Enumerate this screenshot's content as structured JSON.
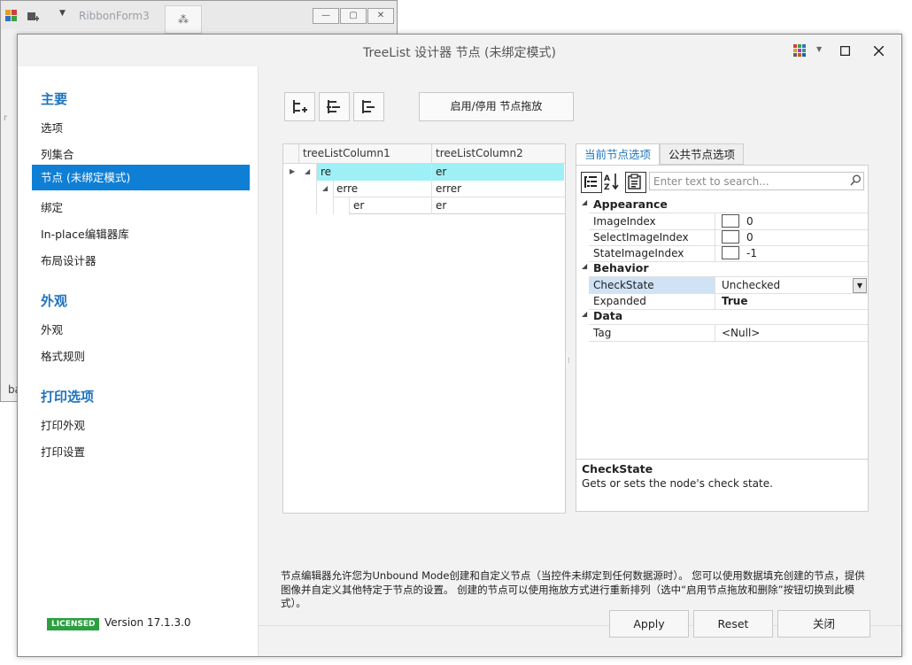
{
  "background_window": {
    "title": "RibbonForm3",
    "ba_text": "ba",
    "r_text": "r"
  },
  "dialog": {
    "title": "TreeList 设计器 节点 (未绑定模式)",
    "icons": [
      "palette-icon",
      "dropdown-arrow-icon",
      "maximize-icon",
      "close-icon"
    ]
  },
  "sidebar": {
    "groups": [
      {
        "label": "主要",
        "items": [
          "选项",
          "列集合",
          "节点 (未绑定模式)",
          "绑定",
          "In-place编辑器库",
          "布局设计器"
        ]
      },
      {
        "label": "外观",
        "items": [
          "外观",
          "格式规则"
        ]
      },
      {
        "label": "打印选项",
        "items": [
          "打印外观",
          "打印设置"
        ]
      }
    ],
    "selected": "节点 (未绑定模式)"
  },
  "toolbar": {
    "drag_button": "启用/停用 节点拖放"
  },
  "tree": {
    "columns": [
      "treeListColumn1",
      "treeListColumn2"
    ],
    "rows": [
      {
        "c1": "re",
        "c2": "er"
      },
      {
        "c1": "erre",
        "c2": "errer"
      },
      {
        "c1": "er",
        "c2": "er"
      }
    ]
  },
  "property_grid": {
    "tabs": [
      "当前节点选项",
      "公共节点选项"
    ],
    "search_placeholder": "Enter text to search...",
    "categories": [
      {
        "name": "Appearance",
        "props": [
          {
            "name": "ImageIndex",
            "value": "0"
          },
          {
            "name": "SelectImageIndex",
            "value": "0"
          },
          {
            "name": "StateImageIndex",
            "value": "-1"
          }
        ]
      },
      {
        "name": "Behavior",
        "props": [
          {
            "name": "CheckState",
            "value": "Unchecked"
          },
          {
            "name": "Expanded",
            "value": "True"
          }
        ]
      },
      {
        "name": "Data",
        "props": [
          {
            "name": "Tag",
            "value": "<Null>"
          }
        ]
      }
    ],
    "selected_prop": "CheckState",
    "description_title": "CheckState",
    "description_text": "Gets or sets the node's check state."
  },
  "note": "节点编辑器允许您为Unbound Mode创建和自定义节点（当控件未绑定到任何数据源时）。 您可以使用数据填充创建的节点，提供图像并自定义其他特定于节点的设置。 创建的节点可以使用拖放方式进行重新排列（选中“启用节点拖放和删除”按钮切换到此模式）。",
  "footer": {
    "license_badge": "LICENSED",
    "version": "Version 17.1.3.0",
    "apply": "Apply",
    "reset": "Reset",
    "close": "关闭"
  }
}
